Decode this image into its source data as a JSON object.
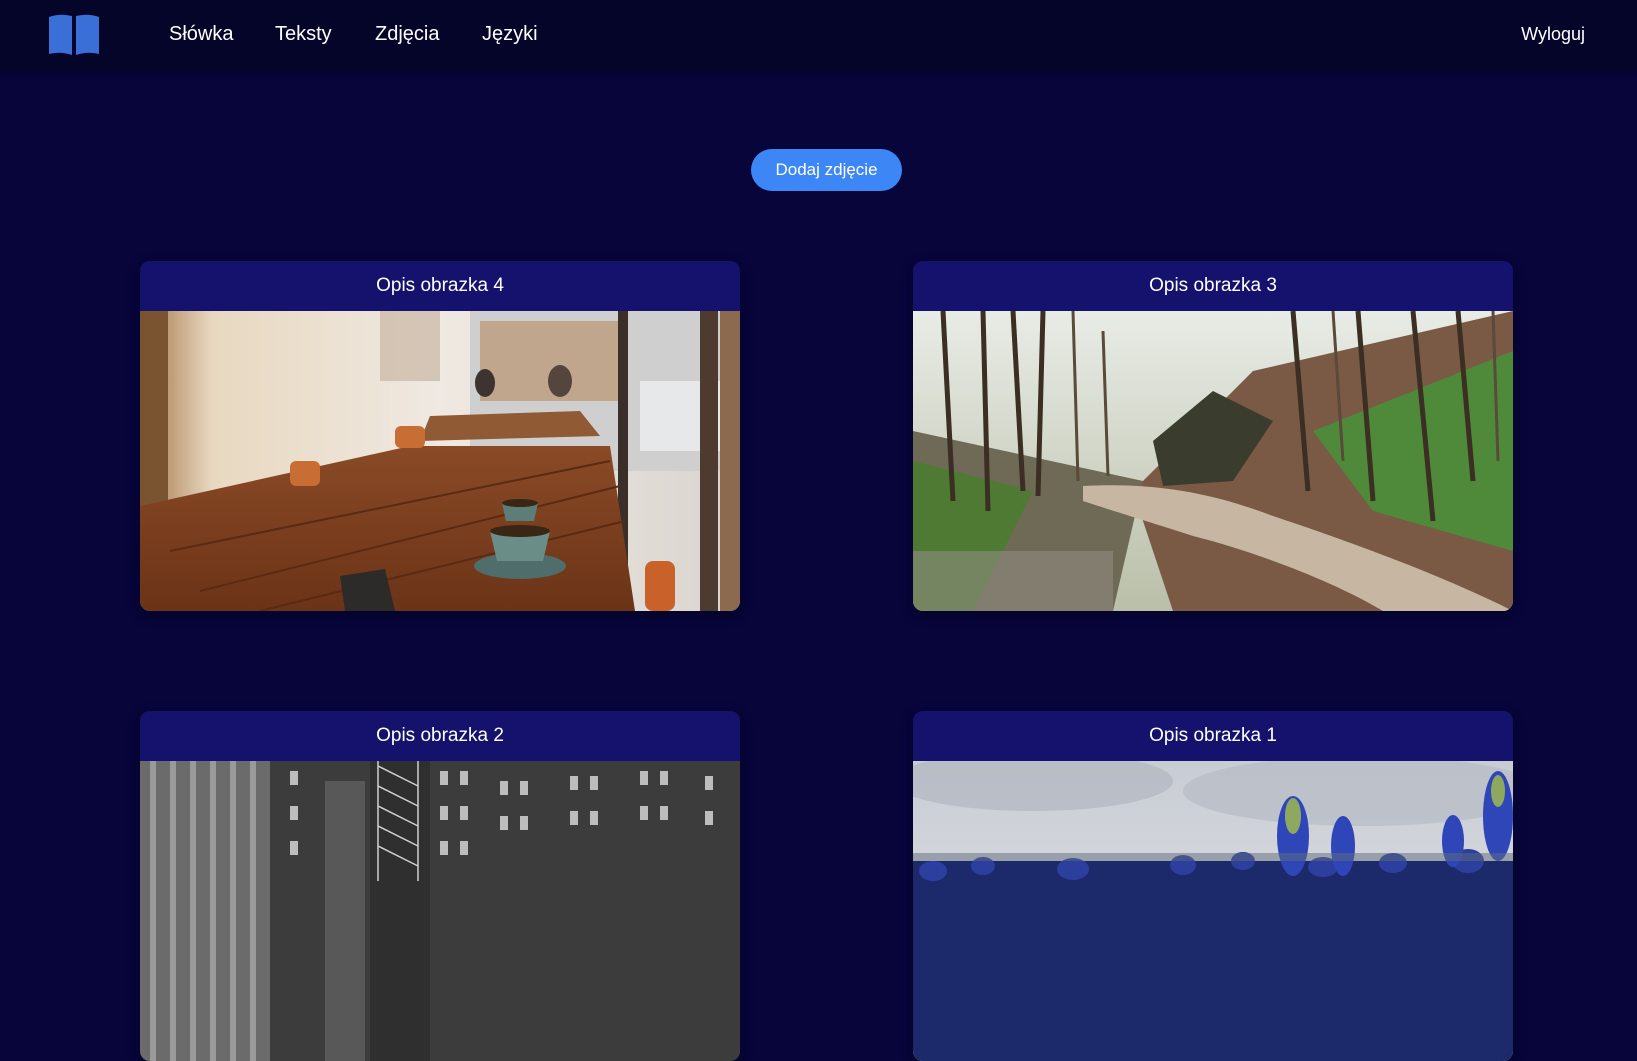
{
  "nav": {
    "logo_icon": "open-book-icon",
    "links": [
      "Słówka",
      "Teksty",
      "Zdjęcia",
      "Języki"
    ],
    "logout": "Wyloguj"
  },
  "actions": {
    "add_photo": "Dodaj zdjęcie"
  },
  "photos": [
    {
      "title": "Opis obrazka 4"
    },
    {
      "title": "Opis obrazka 3"
    },
    {
      "title": "Opis obrazka 2"
    },
    {
      "title": "Opis obrazka 1"
    }
  ],
  "colors": {
    "background": "#07053a",
    "navbar": "#05052a",
    "accent": "#3d86f5",
    "card_header": "#15126e"
  }
}
